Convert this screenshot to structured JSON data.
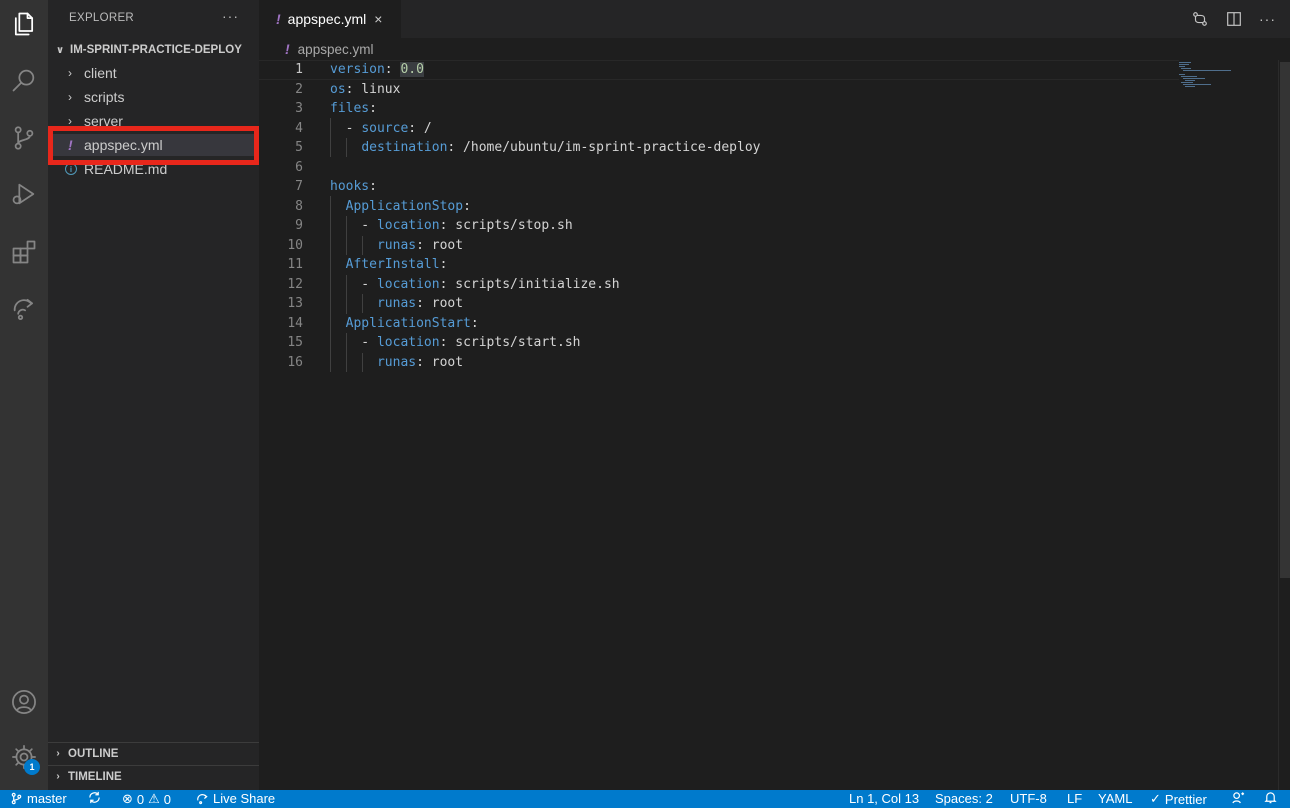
{
  "sidebar": {
    "title": "EXPLORER",
    "more": "···",
    "folder": "IM-SPRINT-PRACTICE-DEPLOY",
    "items": [
      {
        "label": "client"
      },
      {
        "label": "scripts"
      },
      {
        "label": "server"
      },
      {
        "label": "appspec.yml"
      },
      {
        "label": "README.md"
      }
    ],
    "outline": "OUTLINE",
    "timeline": "TIMELINE"
  },
  "activity": {
    "settings_badge": "1"
  },
  "tab": {
    "label": "appspec.yml",
    "close": "×"
  },
  "toolbar": {
    "more": "···"
  },
  "breadcrumb": {
    "file": "appspec.yml"
  },
  "editor": {
    "lines": [
      {
        "n": "1"
      },
      {
        "n": "2"
      },
      {
        "n": "3"
      },
      {
        "n": "4"
      },
      {
        "n": "5"
      },
      {
        "n": "6"
      },
      {
        "n": "7"
      },
      {
        "n": "8"
      },
      {
        "n": "9"
      },
      {
        "n": "10"
      },
      {
        "n": "11"
      },
      {
        "n": "12"
      },
      {
        "n": "13"
      },
      {
        "n": "14"
      },
      {
        "n": "15"
      },
      {
        "n": "16"
      }
    ],
    "code": {
      "l1_key": "version",
      "l1_val": "0.0",
      "l2_key": "os",
      "l2_val": " linux",
      "l3_key": "files",
      "l4_key": "source",
      "l4_val": " /",
      "l5_key": "destination",
      "l5_val": " /home/ubuntu/im-sprint-practice-deploy",
      "l7_key": "hooks",
      "l8_key": "ApplicationStop",
      "l9_key": "location",
      "l9_val": " scripts/stop.sh",
      "l10_key": "runas",
      "l10_val": " root",
      "l11_key": "AfterInstall",
      "l12_key": "location",
      "l12_val": " scripts/initialize.sh",
      "l13_key": "runas",
      "l13_val": " root",
      "l14_key": "ApplicationStart",
      "l15_key": "location",
      "l15_val": " scripts/start.sh",
      "l16_key": "runas",
      "l16_val": " root"
    }
  },
  "status": {
    "branch": "master",
    "errors": "0",
    "warnings": "0",
    "live_share": "Live Share",
    "position": "Ln 1, Col 13",
    "spaces": "Spaces: 2",
    "encoding": "UTF-8",
    "eol": "LF",
    "language": "YAML",
    "prettier": "Prettier"
  },
  "colors": {
    "accent": "#007acc",
    "highlight_box": "#e8271b",
    "yaml_icon": "#a074c4",
    "yaml_key": "#569cd6"
  }
}
